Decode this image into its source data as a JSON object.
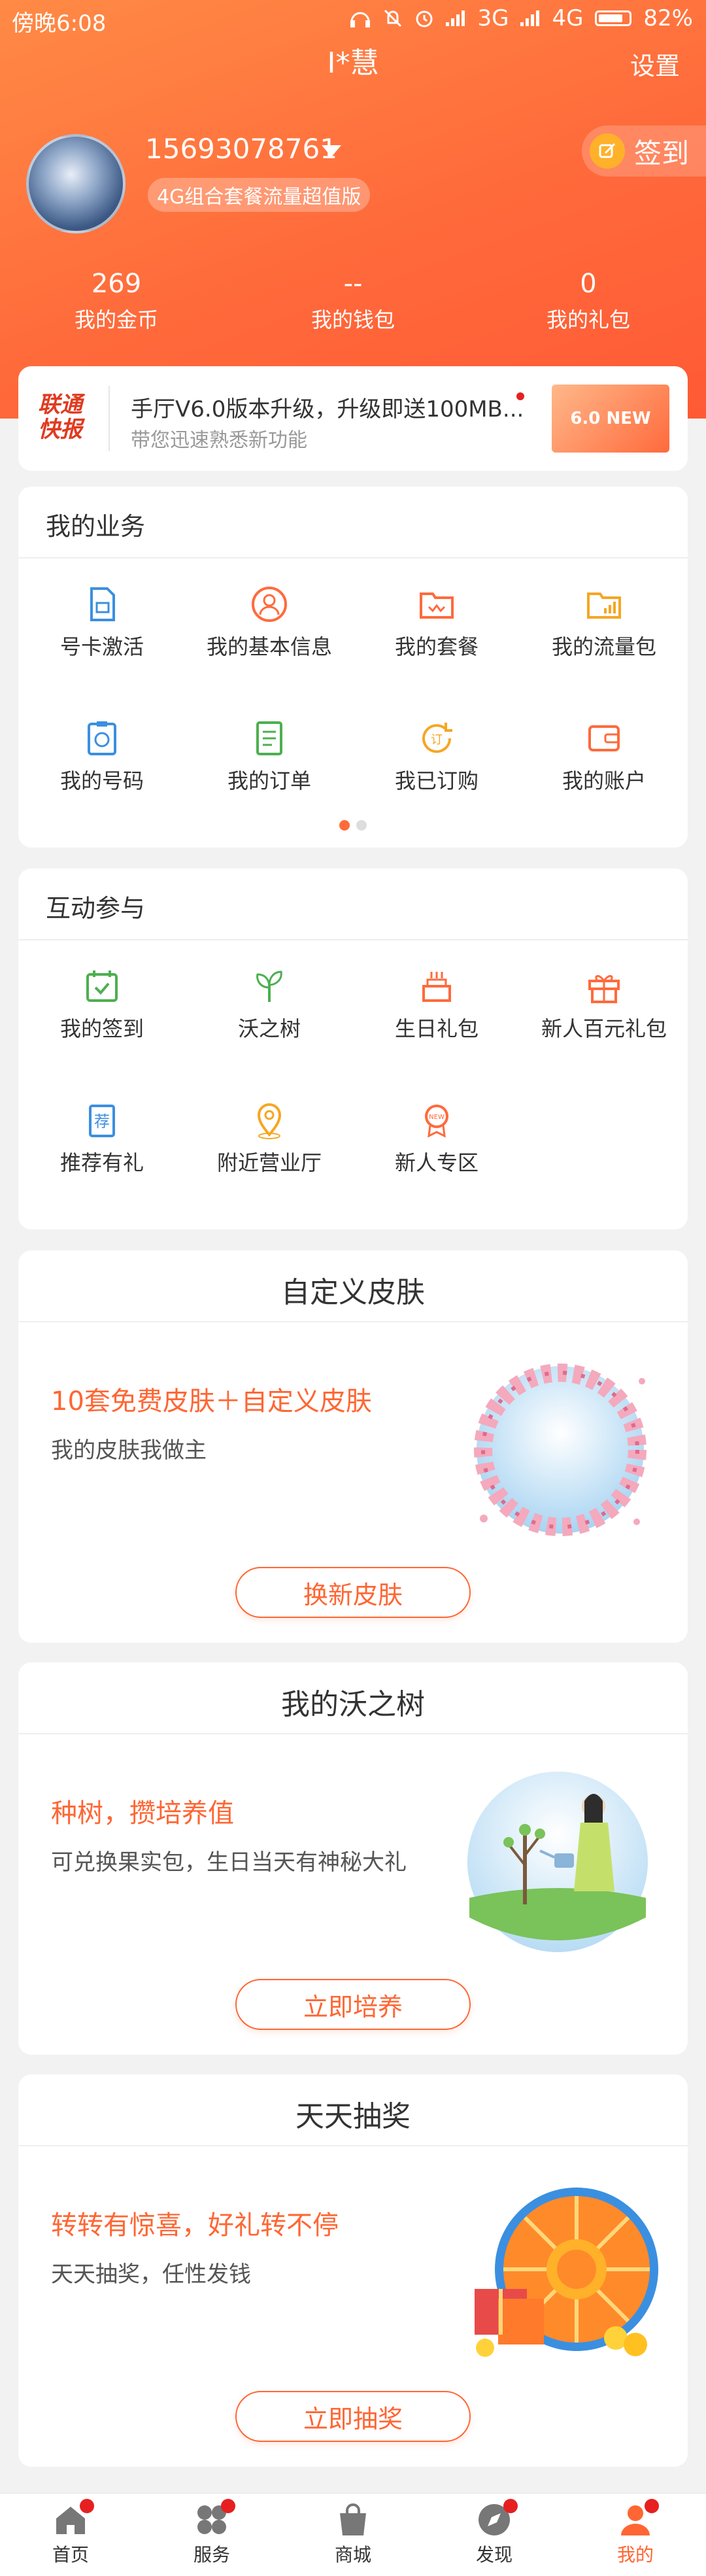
{
  "status_bar": {
    "time": "傍晚6:08",
    "network_1": "3G",
    "network_2": "4G",
    "battery": "82%"
  },
  "header": {
    "title": "I*慧",
    "settings_label": "设置",
    "phone": "15693078761",
    "plan": "4G组合套餐流量超值版",
    "signin_label": "签到"
  },
  "stats": [
    {
      "value": "269",
      "label": "我的金币"
    },
    {
      "value": "--",
      "label": "我的钱包"
    },
    {
      "value": "0",
      "label": "我的礼包"
    }
  ],
  "notice": {
    "logo_line1": "联通",
    "logo_line2": "快报",
    "title": "手厅V6.0版本升级，升级即送100MB...",
    "subtitle": "带您迅速熟悉新功能",
    "banner_text": "6.0 NEW"
  },
  "business": {
    "title": "我的业务",
    "items": [
      {
        "label": "号卡激活",
        "icon": "sim-card-icon"
      },
      {
        "label": "我的基本信息",
        "icon": "user-info-icon"
      },
      {
        "label": "我的套餐",
        "icon": "plan-folder-icon"
      },
      {
        "label": "我的流量包",
        "icon": "data-folder-icon"
      },
      {
        "label": "我的号码",
        "icon": "number-icon"
      },
      {
        "label": "我的订单",
        "icon": "order-icon"
      },
      {
        "label": "我已订购",
        "icon": "subscribed-icon"
      },
      {
        "label": "我的账户",
        "icon": "wallet-icon"
      }
    ]
  },
  "interact": {
    "title": "互动参与",
    "items": [
      {
        "label": "我的签到",
        "icon": "calendar-check-icon"
      },
      {
        "label": "沃之树",
        "icon": "sprout-icon"
      },
      {
        "label": "生日礼包",
        "icon": "cake-icon"
      },
      {
        "label": "新人百元礼包",
        "icon": "gift-icon"
      },
      {
        "label": "推荐有礼",
        "icon": "recommend-icon"
      },
      {
        "label": "附近营业厅",
        "icon": "location-icon"
      },
      {
        "label": "新人专区",
        "icon": "new-user-icon"
      }
    ]
  },
  "skin": {
    "title": "自定义皮肤",
    "promo_title": "10套免费皮肤＋自定义皮肤",
    "promo_sub": "我的皮肤我做主",
    "button": "换新皮肤"
  },
  "tree": {
    "title": "我的沃之树",
    "promo_title": "种树，攒培养值",
    "promo_sub": "可兑换果实包，生日当天有神秘大礼",
    "button": "立即培养"
  },
  "lottery": {
    "title": "天天抽奖",
    "promo_title": "转转有惊喜，好礼转不停",
    "promo_sub": "天天抽奖，任性发钱",
    "button": "立即抽奖"
  },
  "tabbar": [
    {
      "label": "首页",
      "icon": "home-icon",
      "badge": true
    },
    {
      "label": "服务",
      "icon": "service-icon",
      "badge": true
    },
    {
      "label": "商城",
      "icon": "shop-icon",
      "badge": false
    },
    {
      "label": "发现",
      "icon": "compass-icon",
      "badge": true
    },
    {
      "label": "我的",
      "icon": "profile-icon",
      "badge": true,
      "active": true
    }
  ],
  "colors": {
    "accent": "#ff6633",
    "header_top": "#ff8a45",
    "header_bottom": "#ff5a35",
    "badge": "#e62020"
  }
}
